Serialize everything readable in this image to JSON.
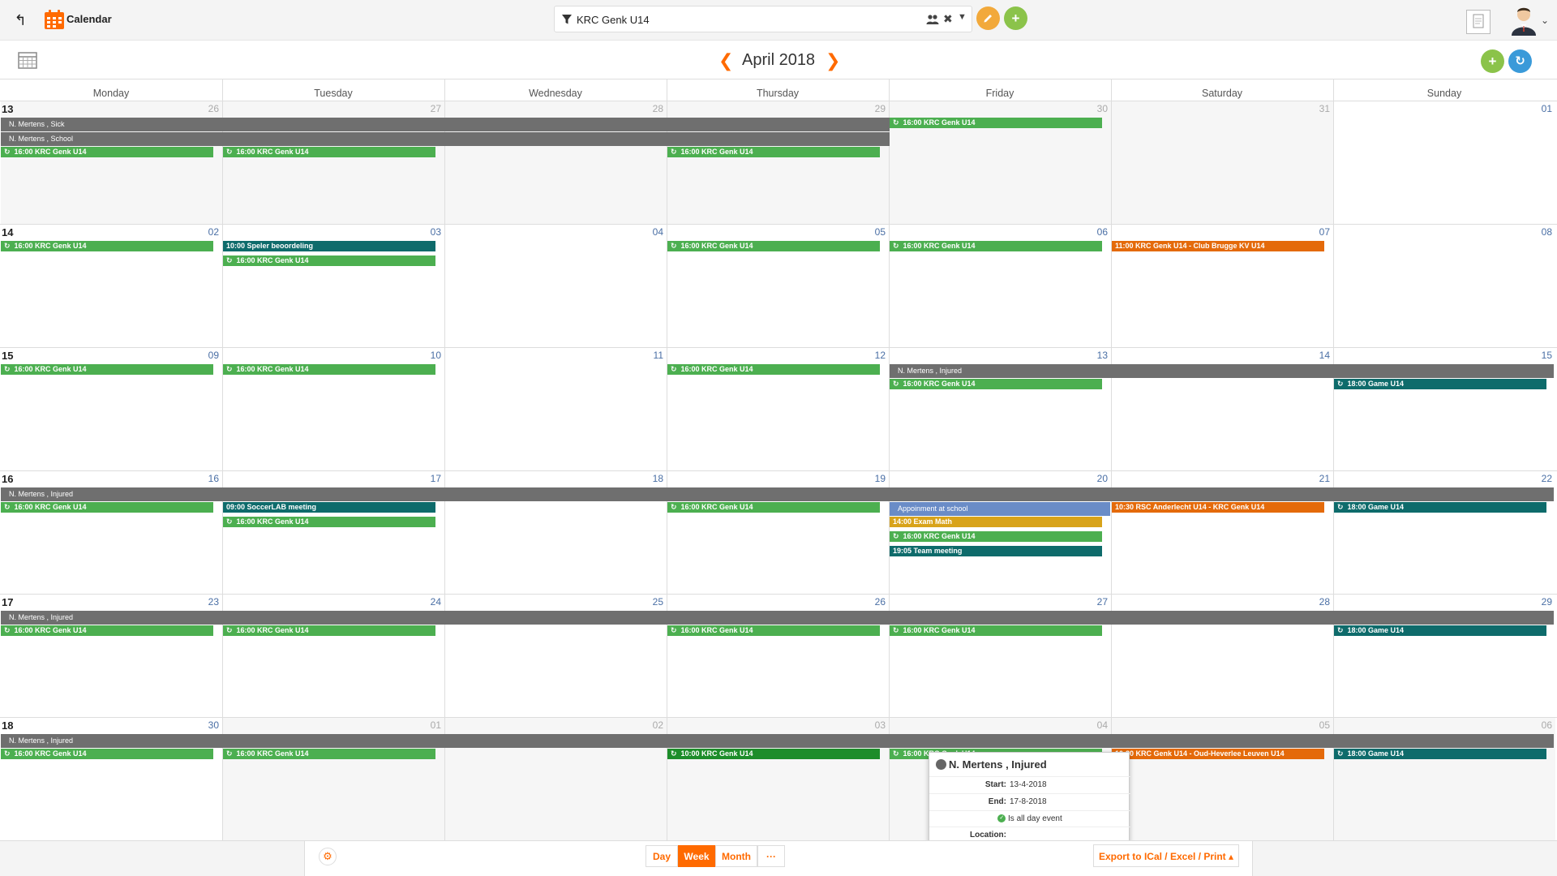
{
  "topbar": {
    "back_icon": "back-arrow-icon",
    "app_title": "Calendar",
    "filter_text": "KRC Genk U14"
  },
  "toolbar": {
    "month_title": "April 2018"
  },
  "days_of_week": [
    "Monday",
    "Tuesday",
    "Wednesday",
    "Thursday",
    "Friday",
    "Saturday",
    "Sunday"
  ],
  "weeks": [
    {
      "week": "13",
      "days": [
        {
          "n": "26",
          "cur": false
        },
        {
          "n": "27",
          "cur": false
        },
        {
          "n": "28",
          "cur": false
        },
        {
          "n": "29",
          "cur": false
        },
        {
          "n": "30",
          "cur": false
        },
        {
          "n": "31",
          "cur": false
        },
        {
          "n": "01",
          "cur": true
        }
      ]
    },
    {
      "week": "14",
      "days": [
        {
          "n": "02",
          "cur": true
        },
        {
          "n": "03",
          "cur": true
        },
        {
          "n": "04",
          "cur": true
        },
        {
          "n": "05",
          "cur": true
        },
        {
          "n": "06",
          "cur": true
        },
        {
          "n": "07",
          "cur": true
        },
        {
          "n": "08",
          "cur": true
        }
      ]
    },
    {
      "week": "15",
      "days": [
        {
          "n": "09",
          "cur": true
        },
        {
          "n": "10",
          "cur": true
        },
        {
          "n": "11",
          "cur": true
        },
        {
          "n": "12",
          "cur": true
        },
        {
          "n": "13",
          "cur": true
        },
        {
          "n": "14",
          "cur": true
        },
        {
          "n": "15",
          "cur": true
        }
      ]
    },
    {
      "week": "16",
      "days": [
        {
          "n": "16",
          "cur": true
        },
        {
          "n": "17",
          "cur": true
        },
        {
          "n": "18",
          "cur": true
        },
        {
          "n": "19",
          "cur": true
        },
        {
          "n": "20",
          "cur": true
        },
        {
          "n": "21",
          "cur": true
        },
        {
          "n": "22",
          "cur": true
        }
      ]
    },
    {
      "week": "17",
      "days": [
        {
          "n": "23",
          "cur": true
        },
        {
          "n": "24",
          "cur": true
        },
        {
          "n": "25",
          "cur": true
        },
        {
          "n": "26",
          "cur": true
        },
        {
          "n": "27",
          "cur": true
        },
        {
          "n": "28",
          "cur": true
        },
        {
          "n": "29",
          "cur": true
        }
      ]
    },
    {
      "week": "18",
      "days": [
        {
          "n": "30",
          "cur": true
        },
        {
          "n": "01",
          "cur": false
        },
        {
          "n": "02",
          "cur": false
        },
        {
          "n": "03",
          "cur": false
        },
        {
          "n": "04",
          "cur": false
        },
        {
          "n": "05",
          "cur": false
        },
        {
          "n": "06",
          "cur": false
        }
      ]
    }
  ],
  "allday_bars": [
    {
      "text": "N. Mertens , Sick",
      "week": 0,
      "start": 0,
      "end": 3,
      "slot": 0
    },
    {
      "text": "N. Mertens , School",
      "week": 0,
      "start": 0,
      "end": 3,
      "slot": 1
    },
    {
      "text": "N. Mertens , Injured",
      "week": 2,
      "start": 4,
      "end": 6,
      "slot": 0
    },
    {
      "text": "N. Mertens , Injured",
      "week": 3,
      "start": 0,
      "end": 6,
      "slot": 0
    },
    {
      "text": "N. Mertens , Injured",
      "week": 4,
      "start": 0,
      "end": 6,
      "slot": 0
    },
    {
      "text": "N. Mertens , Injured",
      "week": 5,
      "start": 0,
      "end": 6,
      "slot": 0
    }
  ],
  "events": [
    {
      "text": "16:00 KRC Genk U14",
      "week": 0,
      "day": 0,
      "slot": 2,
      "color": "green",
      "icon": "sync"
    },
    {
      "text": "16:00 KRC Genk U14",
      "week": 0,
      "day": 1,
      "slot": 2,
      "color": "green",
      "icon": "sync"
    },
    {
      "text": "16:00 KRC Genk U14",
      "week": 0,
      "day": 3,
      "slot": 2,
      "color": "green",
      "icon": "sync"
    },
    {
      "text": "16:00 KRC Genk U14",
      "week": 0,
      "day": 4,
      "slot": 0,
      "color": "green",
      "icon": "sync"
    },
    {
      "text": "16:00 KRC Genk U14",
      "week": 1,
      "day": 0,
      "slot": 0,
      "color": "green",
      "icon": "sync"
    },
    {
      "text": "10:00 Speler beoordeling",
      "week": 1,
      "day": 1,
      "slot": 0,
      "color": "teal",
      "icon": ""
    },
    {
      "text": "16:00 KRC Genk U14",
      "week": 1,
      "day": 1,
      "slot": 1,
      "color": "green",
      "icon": "sync"
    },
    {
      "text": "16:00 KRC Genk U14",
      "week": 1,
      "day": 3,
      "slot": 0,
      "color": "green",
      "icon": "sync"
    },
    {
      "text": "16:00 KRC Genk U14",
      "week": 1,
      "day": 4,
      "slot": 0,
      "color": "green",
      "icon": "sync"
    },
    {
      "text": "11:00 KRC Genk U14 - Club Brugge KV U14",
      "week": 1,
      "day": 5,
      "slot": 0,
      "color": "orange",
      "icon": ""
    },
    {
      "text": "16:00 KRC Genk U14",
      "week": 2,
      "day": 0,
      "slot": 0,
      "color": "green",
      "icon": "sync"
    },
    {
      "text": "16:00 KRC Genk U14",
      "week": 2,
      "day": 1,
      "slot": 0,
      "color": "green",
      "icon": "sync"
    },
    {
      "text": "16:00 KRC Genk U14",
      "week": 2,
      "day": 3,
      "slot": 0,
      "color": "green",
      "icon": "sync"
    },
    {
      "text": "16:00 KRC Genk U14",
      "week": 2,
      "day": 4,
      "slot": 1,
      "color": "green",
      "icon": "sync"
    },
    {
      "text": "18:00 Game U14",
      "week": 2,
      "day": 6,
      "slot": 1,
      "color": "teal",
      "icon": "sync"
    },
    {
      "text": "16:00 KRC Genk U14",
      "week": 3,
      "day": 0,
      "slot": 1,
      "color": "green",
      "icon": "sync"
    },
    {
      "text": "09:00 SoccerLAB meeting",
      "week": 3,
      "day": 1,
      "slot": 1,
      "color": "teal",
      "icon": ""
    },
    {
      "text": "16:00 KRC Genk U14",
      "week": 3,
      "day": 1,
      "slot": 2,
      "color": "green",
      "icon": "sync"
    },
    {
      "text": "16:00 KRC Genk U14",
      "week": 3,
      "day": 3,
      "slot": 1,
      "color": "green",
      "icon": "sync"
    },
    {
      "text": "Appoinment at school",
      "week": 3,
      "day": 4,
      "slot": 1,
      "color": "blue",
      "icon": "",
      "tall": true
    },
    {
      "text": "14:00 Exam Math",
      "week": 3,
      "day": 4,
      "slot": 2,
      "color": "yellow",
      "icon": ""
    },
    {
      "text": "16:00 KRC Genk U14",
      "week": 3,
      "day": 4,
      "slot": 3,
      "color": "green",
      "icon": "sync"
    },
    {
      "text": "19:05 Team meeting",
      "week": 3,
      "day": 4,
      "slot": 4,
      "color": "teal",
      "icon": ""
    },
    {
      "text": "10:30 RSC Anderlecht U14 - KRC Genk U14",
      "week": 3,
      "day": 5,
      "slot": 1,
      "color": "orange",
      "icon": ""
    },
    {
      "text": "18:00 Game U14",
      "week": 3,
      "day": 6,
      "slot": 1,
      "color": "teal",
      "icon": "sync"
    },
    {
      "text": "16:00 KRC Genk U14",
      "week": 4,
      "day": 0,
      "slot": 1,
      "color": "green",
      "icon": "sync"
    },
    {
      "text": "16:00 KRC Genk U14",
      "week": 4,
      "day": 1,
      "slot": 1,
      "color": "green",
      "icon": "sync"
    },
    {
      "text": "16:00 KRC Genk U14",
      "week": 4,
      "day": 3,
      "slot": 1,
      "color": "green",
      "icon": "sync"
    },
    {
      "text": "16:00 KRC Genk U14",
      "week": 4,
      "day": 4,
      "slot": 1,
      "color": "green",
      "icon": "sync"
    },
    {
      "text": "18:00 Game U14",
      "week": 4,
      "day": 6,
      "slot": 1,
      "color": "teal",
      "icon": "sync"
    },
    {
      "text": "16:00 KRC Genk U14",
      "week": 5,
      "day": 0,
      "slot": 1,
      "color": "green",
      "icon": "sync"
    },
    {
      "text": "16:00 KRC Genk U14",
      "week": 5,
      "day": 1,
      "slot": 1,
      "color": "green",
      "icon": "sync"
    },
    {
      "text": "10:00 KRC Genk U14",
      "week": 5,
      "day": 3,
      "slot": 1,
      "color": "dkgreen",
      "icon": "sync"
    },
    {
      "text": "16:00 KRC Genk U14",
      "week": 5,
      "day": 4,
      "slot": 1,
      "color": "green",
      "icon": "sync"
    },
    {
      "text": "10:30 KRC Genk U14 - Oud-Heverlee Leuven U14",
      "week": 5,
      "day": 5,
      "slot": 1,
      "color": "orange",
      "icon": ""
    },
    {
      "text": "18:00 Game U14",
      "week": 5,
      "day": 6,
      "slot": 1,
      "color": "teal",
      "icon": "sync"
    }
  ],
  "popup": {
    "title": "N. Mertens , Injured",
    "start_label": "Start:",
    "start_value": "13-4-2018",
    "end_label": "End:",
    "end_value": "17-8-2018",
    "allday_text": "Is all day event",
    "location_label": "Location:"
  },
  "bottombar": {
    "views": [
      "Day",
      "Week",
      "Month"
    ],
    "active_view": "Week",
    "more_label": "···",
    "export_label": "Export to ICal / Excel / Print ▴"
  },
  "colors": {
    "accent": "#ff6a00",
    "green": "#4caf50",
    "teal": "#0e6b6b",
    "orange": "#e46a0a",
    "gray_bar": "#6f6f6f"
  }
}
